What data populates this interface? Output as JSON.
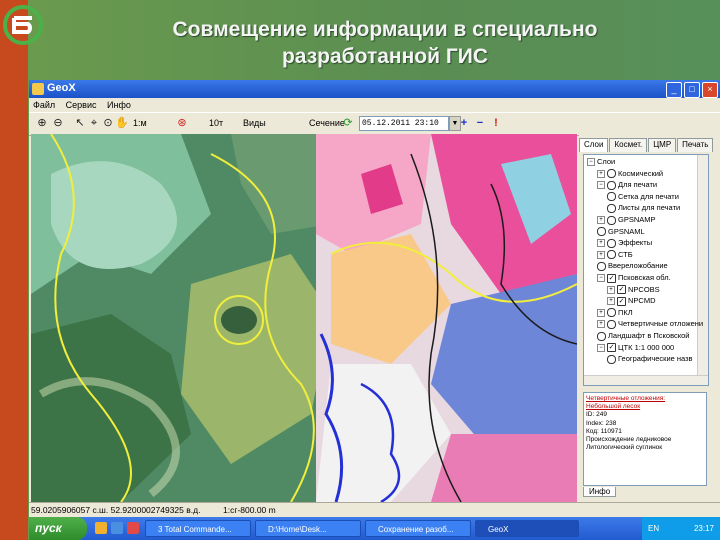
{
  "slide": {
    "title_line1": "Совмещение информации в специально",
    "title_line2": "разработанной ГИС"
  },
  "window": {
    "title": "GeoX",
    "buttons": [
      "_",
      "□",
      "×"
    ]
  },
  "menu": [
    "Файл",
    "Сервис",
    "Инфо"
  ],
  "toolbar": {
    "scale_label": "10т",
    "view_label": "Виды",
    "date_label": "Сечение",
    "date_value": "05.12.2011 23:10",
    "plus": "+",
    "minus": "−",
    "alert": "!",
    "pan_label": "1:м"
  },
  "panel": {
    "tabs": [
      "Слои",
      "Космет.",
      "ЦМР",
      "Печать"
    ],
    "layers": [
      {
        "label": "Слои",
        "level": 0,
        "check": "none",
        "expand": "−"
      },
      {
        "label": "Космический",
        "level": 1,
        "check": "radio",
        "expand": "+"
      },
      {
        "label": "Для печати",
        "level": 1,
        "check": "radio",
        "expand": "−"
      },
      {
        "label": "Сетка для печати",
        "level": 2,
        "check": "radio",
        "expand": ""
      },
      {
        "label": "Листы для печати",
        "level": 2,
        "check": "radio",
        "expand": ""
      },
      {
        "label": "GPSNAMP",
        "level": 1,
        "check": "radio",
        "expand": "+"
      },
      {
        "label": "GPSNAML",
        "level": 1,
        "check": "radio",
        "expand": ""
      },
      {
        "label": "Эффекты",
        "level": 1,
        "check": "radio",
        "expand": "+"
      },
      {
        "label": "СТБ",
        "level": 1,
        "check": "radio",
        "expand": "+"
      },
      {
        "label": "Ввереложобание",
        "level": 1,
        "check": "radio",
        "expand": ""
      },
      {
        "label": "Псковская обл.",
        "level": 1,
        "check": "check",
        "expand": "−"
      },
      {
        "label": "NPCOBS",
        "level": 2,
        "check": "check",
        "expand": "+"
      },
      {
        "label": "NPCMD",
        "level": 2,
        "check": "check",
        "expand": "+"
      },
      {
        "label": "ПКЛ",
        "level": 1,
        "check": "radio",
        "expand": "+"
      },
      {
        "label": "Четвертичные отложени",
        "level": 1,
        "check": "radio",
        "expand": "+"
      },
      {
        "label": "Ландшафт в Псковской",
        "level": 1,
        "check": "radio",
        "expand": ""
      },
      {
        "label": "ЦТК 1:1 000 000",
        "level": 1,
        "check": "check",
        "expand": "−"
      },
      {
        "label": "Географические назв",
        "level": 2,
        "check": "radio",
        "expand": ""
      }
    ],
    "info_lines": [
      "Четвертичные отложения:",
      "Небольшой лесок",
      "ID: 249",
      "Index: 238",
      "Код: 110971",
      "Происхождение ледниковое",
      "Литологический суглинок"
    ],
    "info_tab": "Инфо"
  },
  "status": {
    "coords": "59.0205906057 с.ш. 52.9200002749325 в.д.",
    "scale": "1:сг-800.00 m"
  },
  "taskbar": {
    "start": "пуск",
    "tasks": [
      "3 Total Commande...",
      "D:\\Home\\Desk...",
      "Сохранение разоб...",
      "GeoX"
    ],
    "tray_lang": "EN",
    "clock": "23:17"
  },
  "colors": {
    "title_bar": "#235ad2",
    "map_satellite": "#48805e",
    "map_thematic_pink": "#e94f9a",
    "map_contour_yellow": "#f1ee3c",
    "map_contour_blue": "#2430d6"
  }
}
